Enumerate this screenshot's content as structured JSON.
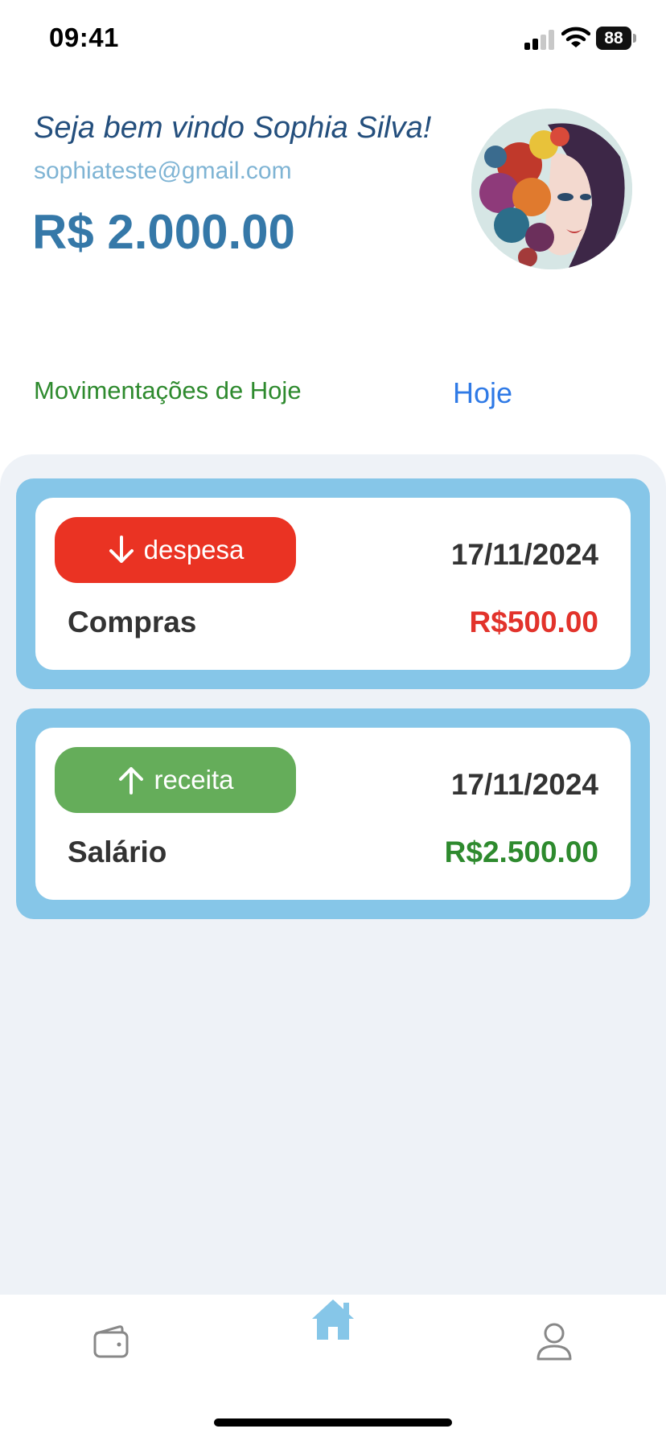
{
  "status_bar": {
    "time": "09:41",
    "battery": "88"
  },
  "header": {
    "greeting": "Seja bem vindo Sophia Silva!",
    "email": "sophiateste@gmail.com",
    "balance": "R$ 2.000.00",
    "avatar_icon": "profile-portrait"
  },
  "section": {
    "title": "Movimentações de Hoje",
    "filter_label": "Hoje"
  },
  "transactions": [
    {
      "type": "despesa",
      "date": "17/11/2024",
      "title": "Compras",
      "amount": "R$500.00",
      "badge_color": "#ea3323",
      "amount_color": "#e2332b",
      "icon": "arrow-down-icon"
    },
    {
      "type": "receita",
      "date": "17/11/2024",
      "title": "Salário",
      "amount": "R$2.500.00",
      "badge_color": "#65ad5a",
      "amount_color": "#2e8a2e",
      "icon": "arrow-up-icon"
    }
  ],
  "bottom_nav": [
    {
      "name": "wallet",
      "icon": "wallet-icon",
      "active": false
    },
    {
      "name": "home",
      "icon": "home-icon",
      "active": true
    },
    {
      "name": "profile",
      "icon": "user-icon",
      "active": false
    }
  ],
  "colors": {
    "card_border": "#86c6e8",
    "list_background": "#eef2f7",
    "nav_active": "#86c6e8",
    "nav_inactive": "#888888"
  }
}
